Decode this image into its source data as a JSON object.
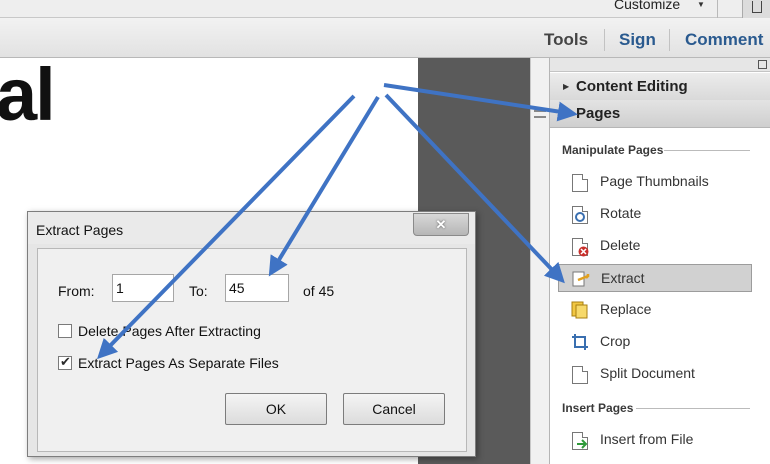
{
  "toolbar": {
    "customize_label": "Customize",
    "tools_label": "Tools",
    "sign_label": "Sign",
    "comment_label": "Comment"
  },
  "document": {
    "visible_text": "al"
  },
  "pane": {
    "content_editing_label": "Content Editing",
    "pages_label": "Pages",
    "manipulate_group": "Manipulate Pages",
    "items": [
      {
        "label": "Page Thumbnails",
        "icon": "page-thumbnails-icon"
      },
      {
        "label": "Rotate",
        "icon": "rotate-icon"
      },
      {
        "label": "Delete",
        "icon": "delete-icon"
      },
      {
        "label": "Extract",
        "icon": "extract-icon",
        "selected": true
      },
      {
        "label": "Replace",
        "icon": "replace-icon"
      },
      {
        "label": "Crop",
        "icon": "crop-icon"
      },
      {
        "label": "Split Document",
        "icon": "split-document-icon"
      }
    ],
    "insert_group": "Insert Pages",
    "insert_items": [
      {
        "label": "Insert from File",
        "icon": "insert-from-file-icon"
      }
    ]
  },
  "dialog": {
    "title": "Extract Pages",
    "close_glyph": "✕",
    "from_label": "From:",
    "from_value": "1",
    "to_label": "To:",
    "to_value": "45",
    "of_label": "of 45",
    "delete_after_label": "Delete Pages After Extracting",
    "delete_after_checked": false,
    "separate_files_label": "Extract Pages As Separate Files",
    "separate_files_checked": true,
    "ok_label": "OK",
    "cancel_label": "Cancel"
  },
  "colors": {
    "annotation_arrow": "#3f73c4",
    "tab_link": "#2a5a8f",
    "doc_gutter": "#5a5a5a"
  }
}
